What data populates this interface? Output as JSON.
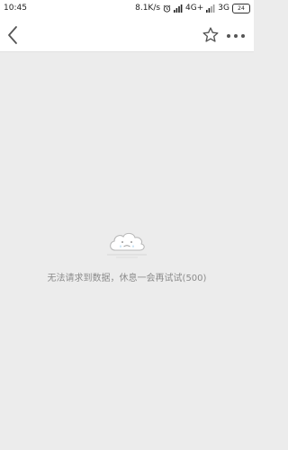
{
  "status_bar": {
    "time": "10:45",
    "network_speed": "8.1K/s",
    "network_type": "4G+",
    "network_type_2": "3G",
    "battery_level": "24",
    "icons": [
      "alarm-icon",
      "signal-icon",
      "signal-icon"
    ]
  },
  "nav_bar": {
    "icons": [
      "back-arrow-icon",
      "star-icon",
      "more-icon"
    ]
  },
  "content": {
    "illustration": "sad-cloud-icon",
    "error_message": "无法请求到数据，休息一会再试试(500)"
  },
  "colors": {
    "background": "#ececec",
    "bar_background": "#ffffff",
    "message_text": "#8c8c8c",
    "icon_stroke": "#555555"
  }
}
